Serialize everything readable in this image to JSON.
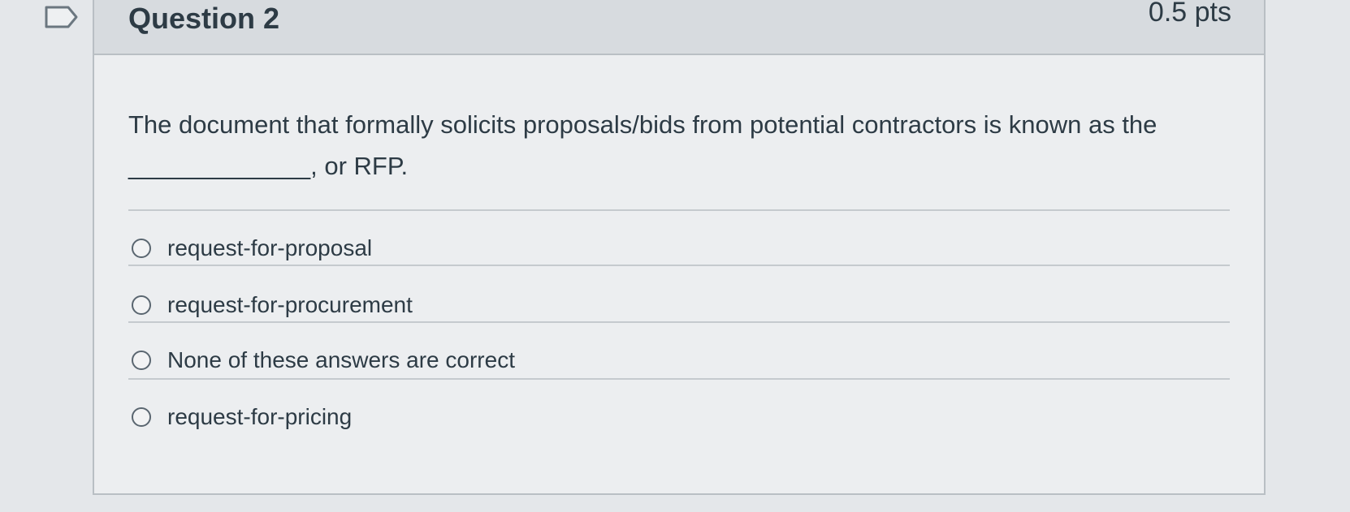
{
  "question": {
    "title": "Question 2",
    "points": "0.5 pts",
    "text": "The document that formally solicits proposals/bids from potential contractors is known as the _____________, or RFP.",
    "answers": [
      {
        "label": "request-for-proposal",
        "selected": false
      },
      {
        "label": "request-for-procurement",
        "selected": false
      },
      {
        "label": "None of these answers are correct",
        "selected": false
      },
      {
        "label": "request-for-pricing",
        "selected": false
      }
    ]
  },
  "icons": {
    "flag": "flag-question-icon",
    "radio": "radio-button-icon"
  },
  "colors": {
    "text": "#2d3b45",
    "header_background": "#d7dbdf",
    "card_background": "#eceef0",
    "border": "#b9bfc4"
  }
}
